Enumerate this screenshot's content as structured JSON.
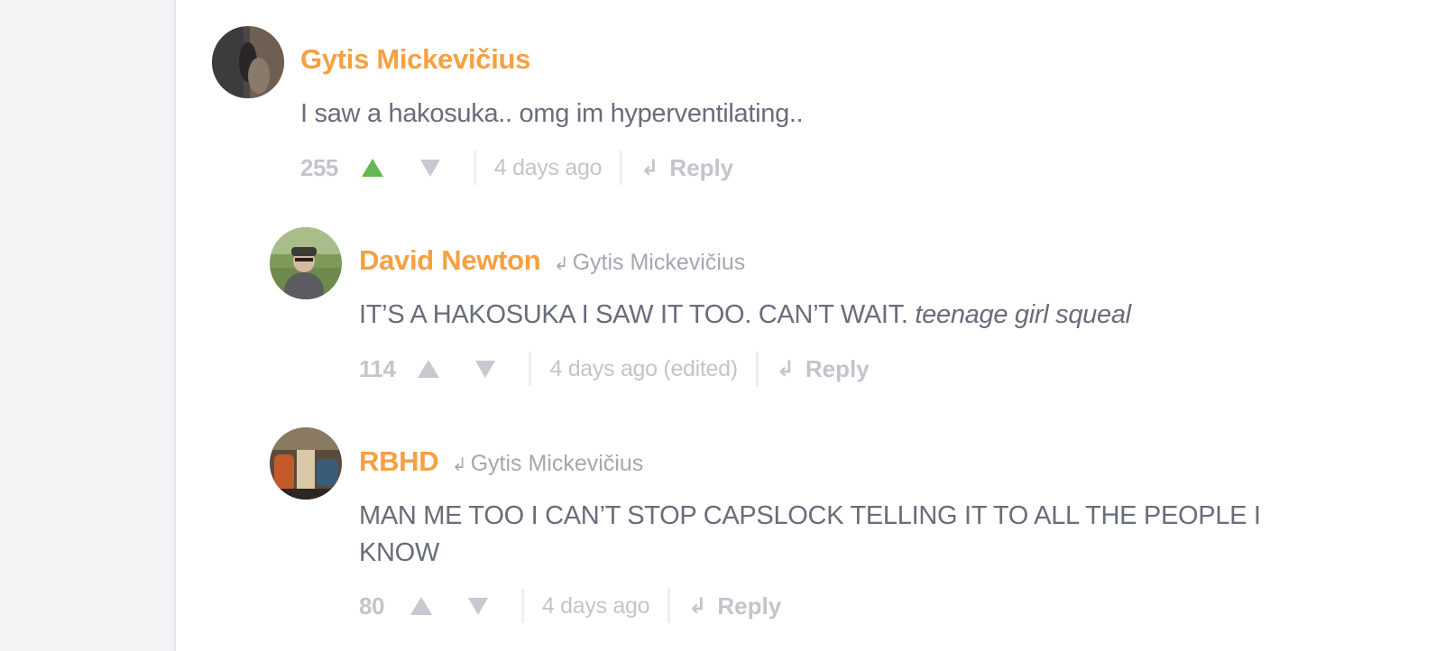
{
  "colors": {
    "author": "#f7a042",
    "body_text": "#696c7a",
    "meta_text": "#c3c5cc",
    "upvote_active": "#66b653",
    "sidebar_bg": "#f4f4f6"
  },
  "comments": [
    {
      "author": "Gytis Mickevičius",
      "reply_to": "",
      "text": "I saw a hakosuka.. omg im hyperventilating..",
      "text_italic": "",
      "count": "255",
      "upvoted": true,
      "timestamp": "4 days ago",
      "reply_label": "Reply",
      "avatar_icon": "avatar-photo"
    },
    {
      "author": "David Newton",
      "reply_to": "Gytis Mickevičius",
      "text": "IT’S A HAKOSUKA I SAW IT TOO. CAN’T WAIT.",
      "text_italic": "teenage girl squeal",
      "count": "114",
      "upvoted": false,
      "timestamp": "4 days ago (edited)",
      "reply_label": "Reply",
      "avatar_icon": "avatar-photo"
    },
    {
      "author": "RBHD",
      "reply_to": "Gytis Mickevičius",
      "text": "MAN ME TOO I CAN’T STOP CAPSLOCK TELLING IT TO ALL THE PEOPLE I KNOW",
      "text_italic": "",
      "count": "80",
      "upvoted": false,
      "timestamp": "4 days ago",
      "reply_label": "Reply",
      "avatar_icon": "avatar-photo"
    }
  ],
  "icons": {
    "upvote": "triangle-up",
    "downvote": "triangle-down",
    "reply": "reply-arrow"
  }
}
